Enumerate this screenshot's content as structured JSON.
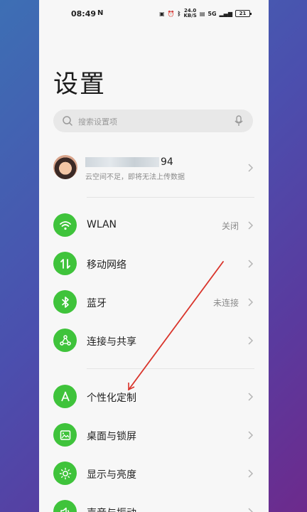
{
  "status_bar": {
    "time": "08:49",
    "notify_indicator": "N",
    "net_speed_value": "24.0",
    "net_speed_unit": "KB/S",
    "network_type": "5G",
    "battery": "21"
  },
  "page_title": "设置",
  "search": {
    "placeholder": "搜索设置项"
  },
  "account": {
    "name_suffix": "94",
    "subtitle": "云空间不足，即将无法上传数据"
  },
  "items": [
    {
      "label": "WLAN",
      "value": "关闭",
      "icon": "wifi-icon"
    },
    {
      "label": "移动网络",
      "value": "",
      "icon": "mobile-data-icon"
    },
    {
      "label": "蓝牙",
      "value": "未连接",
      "icon": "bluetooth-icon"
    },
    {
      "label": "连接与共享",
      "value": "",
      "icon": "share-icon"
    },
    {
      "label": "个性化定制",
      "value": "",
      "icon": "customize-icon"
    },
    {
      "label": "桌面与锁屏",
      "value": "",
      "icon": "wallpaper-icon"
    },
    {
      "label": "显示与亮度",
      "value": "",
      "icon": "brightness-icon"
    },
    {
      "label": "声音与振动",
      "value": "",
      "icon": "sound-icon"
    }
  ],
  "colors": {
    "accent": "#3fc33b",
    "annotation": "#d9342b"
  }
}
